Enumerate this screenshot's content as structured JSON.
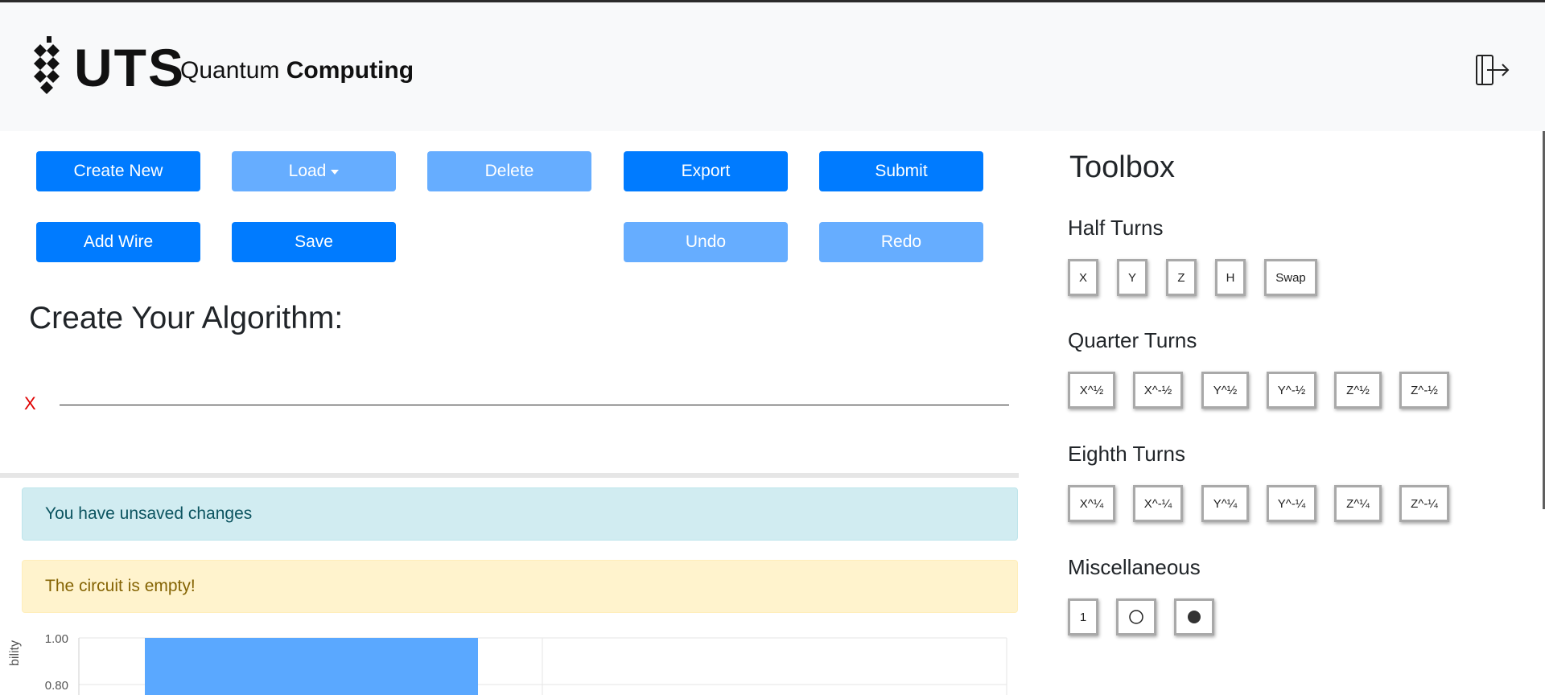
{
  "header": {
    "logo_text": "UTS",
    "brand_regular": "Quantum",
    "brand_bold": "Computing",
    "logout_icon": "logout-icon"
  },
  "toolbar": {
    "create_new": "Create New",
    "load": "Load",
    "delete": "Delete",
    "export": "Export",
    "submit": "Submit",
    "add_wire": "Add Wire",
    "save": "Save",
    "undo": "Undo",
    "redo": "Redo"
  },
  "editor": {
    "title": "Create Your Algorithm:",
    "wires": [
      {
        "label": "X"
      }
    ]
  },
  "alerts": {
    "info": "You have unsaved changes",
    "warning": "The circuit is empty!"
  },
  "chart_data": {
    "type": "bar",
    "ylabel": "bility",
    "yticks": [
      "1.00",
      "0.80"
    ],
    "values": [
      1.0
    ],
    "color": "#5aa8ff"
  },
  "toolbox": {
    "title": "Toolbox",
    "sections": [
      {
        "title": "Half Turns",
        "gates": [
          "X",
          "Y",
          "Z",
          "H",
          "Swap"
        ]
      },
      {
        "title": "Quarter Turns",
        "gates": [
          "X^½",
          "X^-½",
          "Y^½",
          "Y^-½",
          "Z^½",
          "Z^-½"
        ]
      },
      {
        "title": "Eighth Turns",
        "gates": [
          "X^¼",
          "X^-¼",
          "Y^¼",
          "Y^-¼",
          "Z^¼",
          "Z^-¼"
        ]
      },
      {
        "title": "Miscellaneous",
        "gates": [
          "1"
        ]
      }
    ]
  },
  "colors": {
    "primary": "#007bff",
    "primary_disabled": "#66adff",
    "wire_label": "#e00000"
  }
}
